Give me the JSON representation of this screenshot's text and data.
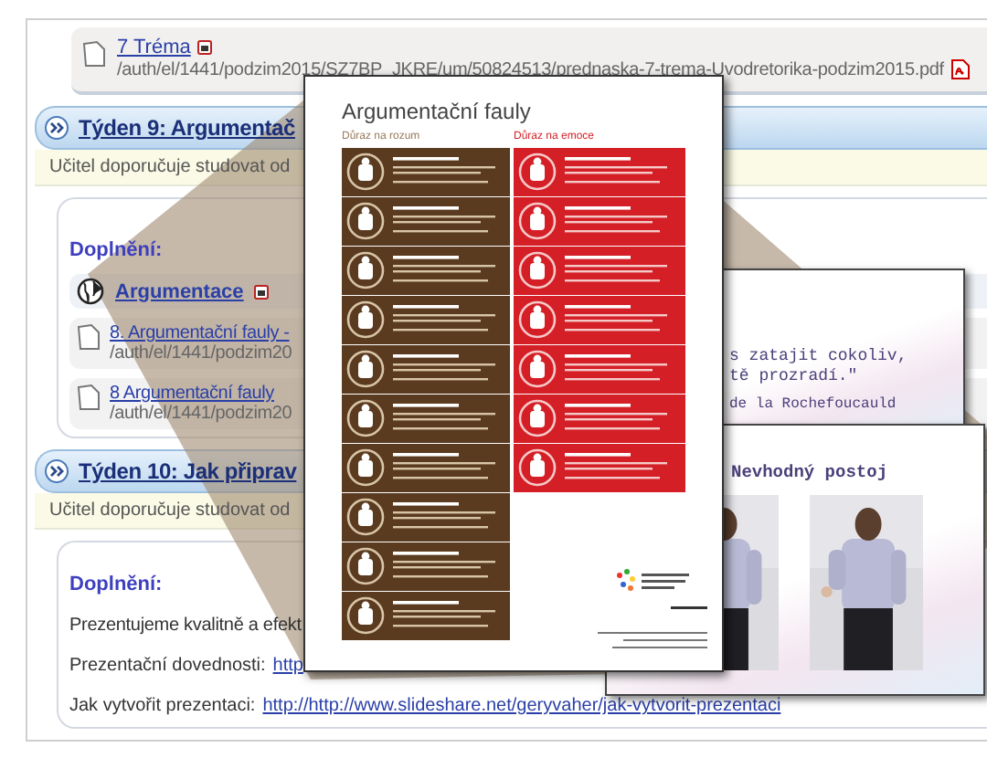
{
  "top_file": {
    "title": "7 Tréma",
    "path": "/auth/el/1441/podzim2015/SZ7BP_JKRE/um/50824513/prednaska-7-trema-Uvodretorika-podzim2015.pdf"
  },
  "weeks": [
    {
      "title": "Týden 9: Argumentač",
      "note": "Učitel doporučuje studovat od",
      "section": "Doplnění:",
      "items": [
        {
          "kind": "link",
          "title": "Argumentace"
        },
        {
          "kind": "file",
          "title": "8. Argumentační fauly -",
          "path": "/auth/el/1441/podzim20"
        },
        {
          "kind": "file",
          "title": "8 Argumentační fauly",
          "path": "/auth/el/1441/podzim20"
        }
      ]
    },
    {
      "title": "Týden 10: Jak připrav",
      "note": "Učitel doporučuje studovat od",
      "section": "Doplnění:",
      "items": [
        {
          "kind": "text",
          "text": "Prezentujeme kvalitně a efekt"
        },
        {
          "kind": "labeled_link",
          "label": "Prezentační dovednosti:",
          "link": "http"
        },
        {
          "kind": "labeled_link",
          "label": "Jak vytvořit prezentaci:",
          "link": "http://http://www.slideshare.net/geryvaher/jak-vytvorit-prezentaci"
        }
      ]
    }
  ],
  "infographic": {
    "title": "Argumentační fauly",
    "columns": [
      {
        "kind": "reason",
        "heading": "Důraz na rozum"
      },
      {
        "kind": "emotion",
        "heading": "Důraz na emoce"
      }
    ]
  },
  "slides": [
    {
      "kind": "quote",
      "lines": [
        "s zatajit cokoliv,",
        "tě prozradí.\""
      ],
      "author": "de la Rochefoucauld"
    },
    {
      "kind": "photos",
      "title": "Nevhodný postoj"
    }
  ]
}
